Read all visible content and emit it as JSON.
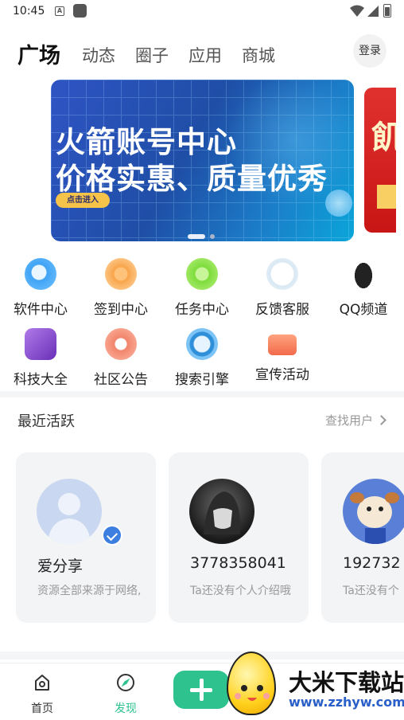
{
  "status_bar": {
    "time": "10:45",
    "a_icon": "A"
  },
  "top_nav": {
    "tabs": [
      {
        "label": "广场",
        "active": true
      },
      {
        "label": "动态",
        "active": false
      },
      {
        "label": "圈子",
        "active": false
      },
      {
        "label": "应用",
        "active": false
      },
      {
        "label": "商城",
        "active": false
      }
    ],
    "login_label": "登录"
  },
  "banner": {
    "line1": "火箭账号中心",
    "line2": "价格实惠、质量优秀",
    "cta": "点击进入",
    "next_banner_char": "飢",
    "page_count": 2,
    "active_page": 1
  },
  "shortcuts": [
    {
      "label": "软件中心",
      "icon": "software-center-icon",
      "color": "#3fa3f5"
    },
    {
      "label": "签到中心",
      "icon": "checkin-calendar-icon",
      "color": "#f8a54a"
    },
    {
      "label": "任务中心",
      "icon": "task-flag-icon",
      "color": "#7ddc3b"
    },
    {
      "label": "反馈客服",
      "icon": "feedback-badge-icon",
      "color": "#d8e8f3"
    },
    {
      "label": "QQ频道",
      "icon": "qq-penguin-icon",
      "color": "#222222"
    },
    {
      "label": "科技大全",
      "icon": "gg-shield-icon",
      "color": "#8b4fd0"
    },
    {
      "label": "社区公告",
      "icon": "megaphone-icon",
      "color": "#f0846a"
    },
    {
      "label": "搜索引擎",
      "icon": "search-globe-icon",
      "color": "#2f8fd8"
    },
    {
      "label": "宣传活动",
      "icon": "gift-event-icon",
      "color": "#f26a4b"
    }
  ],
  "recent_active": {
    "title": "最近活跃",
    "find_users": "查找用户",
    "users": [
      {
        "name": "爱分享",
        "desc": "资源全部来源于网络,",
        "avatar": "default-user-avatar",
        "verified": true
      },
      {
        "name": "3778358041",
        "desc": "Ta还没有个人介绍哦",
        "avatar": "dark-anime-avatar",
        "verified": false
      },
      {
        "name": "192732",
        "desc": "Ta还没有个",
        "avatar": "cartoon-dog-avatar",
        "verified": false
      }
    ]
  },
  "bottom_bar": {
    "items": [
      {
        "label": "首页",
        "active": false
      },
      {
        "label": "发现",
        "active": true
      }
    ],
    "accent": "#2ec28f"
  },
  "watermark": {
    "title": "大米下载站",
    "url": "www.zzhyw.com"
  }
}
